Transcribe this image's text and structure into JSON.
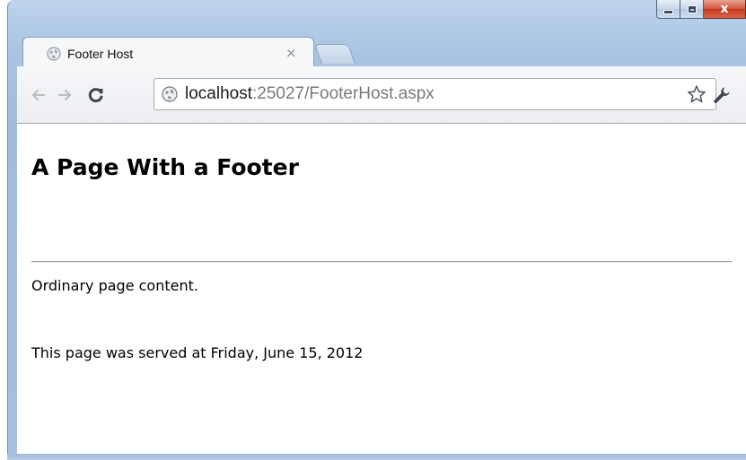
{
  "window": {
    "minimize_symbol": "",
    "close_symbol": "x"
  },
  "tab": {
    "title": "Footer Host",
    "close_symbol": "×"
  },
  "toolbar": {
    "url_host": "localhost",
    "url_rest": ":25027/FooterHost.aspx"
  },
  "page": {
    "heading": "A Page With a Footer",
    "content": "Ordinary page content.",
    "footer": "This page was served at Friday, June 15, 2012"
  },
  "colors": {
    "frame": "#a9c4e2",
    "close_button": "#c4381e",
    "url_host": "#1a1a1a",
    "url_path": "#7a7a7a"
  }
}
